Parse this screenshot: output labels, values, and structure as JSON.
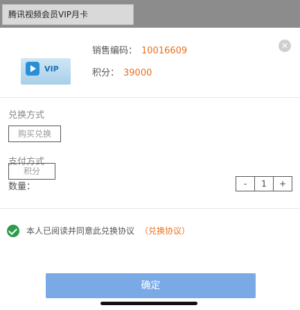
{
  "header": {
    "title": "腾讯视频会员VIP月卡"
  },
  "product": {
    "thumb_brand": "VIP",
    "code_label": "销售编码：",
    "code_value": "10016609",
    "points_label": "积分：",
    "points_value": "39000"
  },
  "redeem_method": {
    "label": "兑换方式",
    "option": "购买兑换"
  },
  "pay_method": {
    "label": "支付方式",
    "option": "积分"
  },
  "quantity": {
    "label": "数量：",
    "minus": "-",
    "value": "1",
    "plus": "+"
  },
  "agreement": {
    "text": "本人已阅读并同意此兑换协议",
    "link": "（兑换协议）"
  },
  "confirm_label": "确定",
  "icons": {
    "close": "close-icon",
    "play": "play-icon",
    "check": "check-icon"
  },
  "colors": {
    "accent_orange": "#e8701a",
    "confirm_blue": "#7aaae6",
    "check_green": "#2e9a4b"
  }
}
